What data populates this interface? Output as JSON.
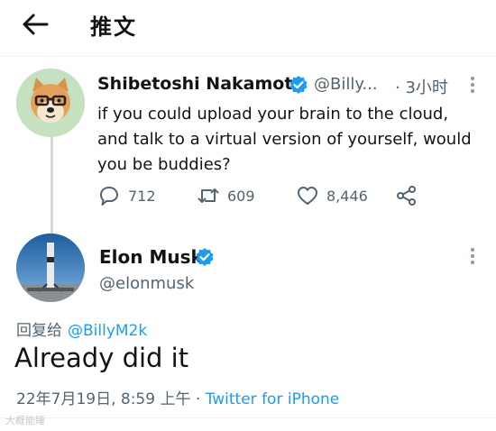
{
  "header": {
    "title": "推文"
  },
  "parent_tweet": {
    "display_name": "Shibetoshi Nakamoto",
    "handle": "@Billy...",
    "time": "· 3小时",
    "text": "if you could upload your brain to the cloud, and talk to a virtual version of yourself, would you be buddies?",
    "replies": "712",
    "retweets": "609",
    "likes": "8,446"
  },
  "main_tweet": {
    "display_name": "Elon Musk",
    "handle": "@elonmusk",
    "reply_prefix": "回复给",
    "reply_mention": "@BillyM2k",
    "text": "Already did it",
    "timestamp": "22年7月19日, 8:59 上午 · ",
    "source": "Twitter for iPhone"
  },
  "watermark": "大概能睡",
  "colors": {
    "accent": "#1d9bf0",
    "secondary_text": "#536471",
    "verified": "#1d9bf0"
  }
}
